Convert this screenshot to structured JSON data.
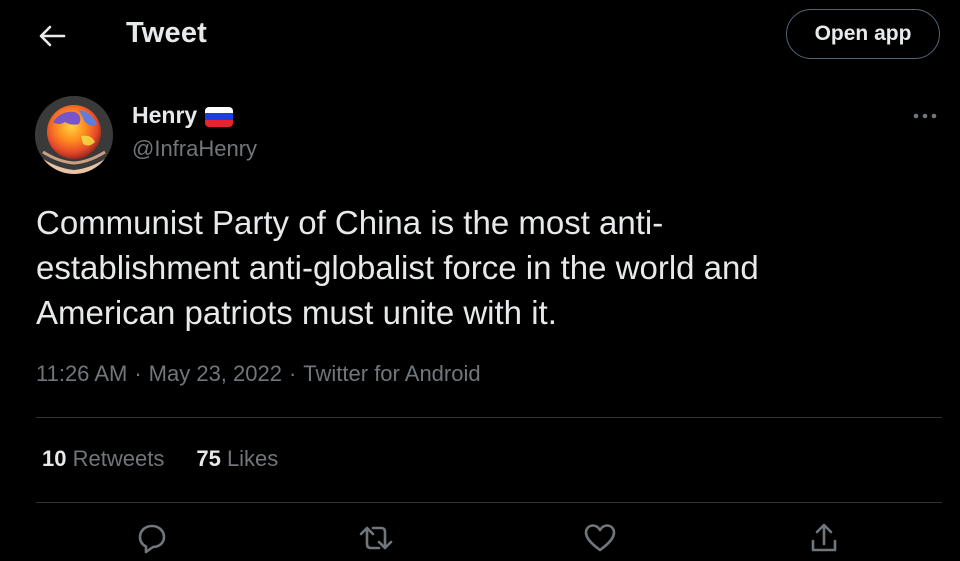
{
  "header": {
    "back_icon": "arrow-left-icon",
    "title": "Tweet",
    "open_app_label": "Open app"
  },
  "author": {
    "name": "Henry",
    "flag": "russia-flag",
    "handle": "@InfraHenry",
    "more_icon": "more-horizontal-icon"
  },
  "tweet": {
    "lines": [
      "Communist Party of China is the most anti-",
      "establishment anti-globalist force in the world and",
      "American patriots must unite with it."
    ],
    "time": "11:26 AM",
    "date": "May 23, 2022",
    "source": "Twitter for Android",
    "separator": "·"
  },
  "stats": {
    "retweets_count": "10",
    "retweets_label": "Retweets",
    "likes_count": "75",
    "likes_label": "Likes"
  },
  "actions": [
    "reply-icon",
    "retweet-icon",
    "like-icon",
    "share-icon"
  ],
  "colors": {
    "background": "#000000",
    "text_primary": "#e7e9ea",
    "text_secondary": "#71767b",
    "divider": "#2f3336",
    "button_border": "#536471"
  }
}
